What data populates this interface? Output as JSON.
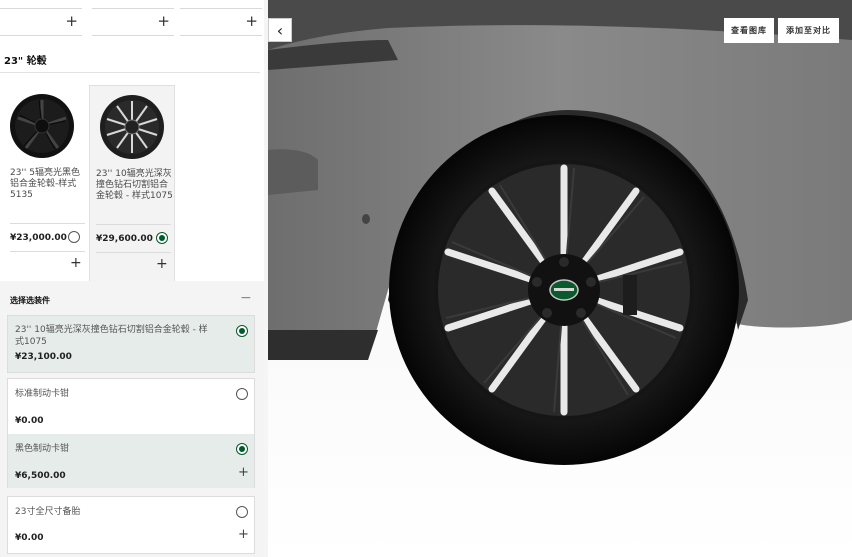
{
  "section": {
    "title": "23\" 轮毂"
  },
  "wheels": [
    {
      "name": "23'' 5辐亮光黑色铝合金轮毂-样式5135",
      "price": "¥23,000.00",
      "selected": false
    },
    {
      "name": "23'' 10辐亮光深灰撞色钻石切割铝合金轮毂 - 样式1075",
      "price": "¥29,600.00",
      "selected": true
    }
  ],
  "options": {
    "title": "选择选装件",
    "items": [
      {
        "name": "23'' 10辐亮光深灰撞色钻石切割铝合金轮毂 - 样式1075",
        "price": "¥23,100.00",
        "selected": true
      },
      {
        "name": "标准制动卡钳",
        "price": "¥0.00",
        "selected": false
      },
      {
        "name": "黑色制动卡钳",
        "price": "¥6,500.00",
        "selected": true
      },
      {
        "name": "23寸全尺寸备胎",
        "price": "¥0.00",
        "selected": false
      }
    ]
  },
  "toolbar": {
    "gallery_label": "查看图库",
    "compare_label": "添加至对比"
  },
  "colors": {
    "accent": "#005a2b"
  },
  "icons": {
    "back": "chevron-left-icon",
    "add": "plus-icon",
    "collapse": "minus-icon"
  }
}
